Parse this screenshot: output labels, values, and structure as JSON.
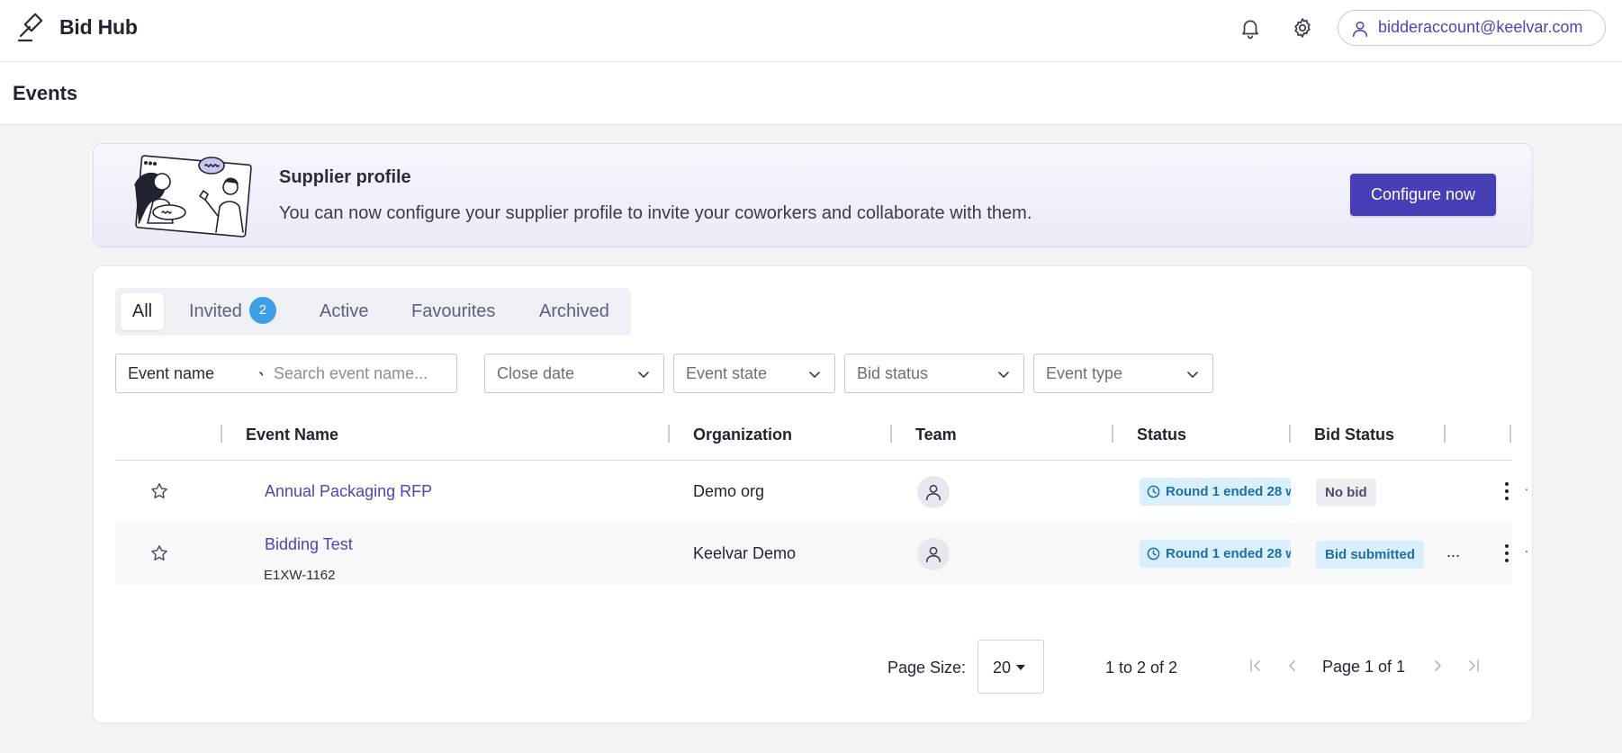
{
  "app": {
    "title": "Bid Hub",
    "account_email": "bidderaccount@keelvar.com"
  },
  "page": {
    "title": "Events"
  },
  "banner": {
    "title": "Supplier profile",
    "text": "You can now configure your supplier profile to invite your coworkers and collaborate with them.",
    "button_label": "Configure now"
  },
  "tabs": [
    {
      "label": "All",
      "active": true
    },
    {
      "label": "Invited",
      "badge": "2"
    },
    {
      "label": "Active"
    },
    {
      "label": "Favourites"
    },
    {
      "label": "Archived"
    }
  ],
  "filters": {
    "field_select": "Event name",
    "search_placeholder": "Search event name...",
    "close_date": "Close date",
    "event_state": "Event state",
    "bid_status": "Bid status",
    "event_type": "Event type"
  },
  "table": {
    "columns": [
      "Event Name",
      "Organization",
      "Team",
      "Status",
      "Bid Status"
    ],
    "rows": [
      {
        "event_name": "Annual Packaging RFP",
        "event_id": "",
        "organization": "Demo org",
        "status": "Round 1 ended 28 w",
        "bid_status": "No bid",
        "favourite": false
      },
      {
        "event_name": "Bidding Test",
        "event_id": "E1XW-1162",
        "organization": "Keelvar Demo",
        "status": "Round 1 ended 28 w",
        "bid_status": "Bid submitted",
        "favourite": false
      }
    ]
  },
  "pagination": {
    "page_size_label": "Page Size:",
    "page_size": "20",
    "range": "1 to 2 of 2",
    "page_info": "Page 1 of 1"
  },
  "colors": {
    "accent": "#463fb6",
    "link": "#4b46b5",
    "badge": "#3d9ee6",
    "status_bg": "#d9effc"
  }
}
